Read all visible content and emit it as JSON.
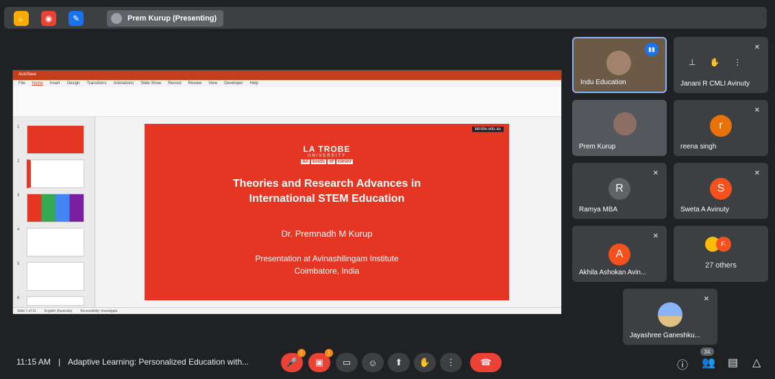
{
  "topbar": {
    "presenter_label": "Prem Kurup (Presenting)",
    "icons": [
      "hand-wave-icon",
      "record-icon",
      "edit-icon"
    ]
  },
  "presentation": {
    "title_bar_text": "AutoSave",
    "ribbon_tabs": [
      "File",
      "Home",
      "Insert",
      "Design",
      "Transitions",
      "Animations",
      "Slide Show",
      "Record",
      "Review",
      "View",
      "Developer",
      "Help"
    ],
    "slide": {
      "badge": "latrobe.edu.au",
      "logo_line1": "LA TROBE",
      "logo_line2": "UNIVERSITY",
      "tagline_all": "All",
      "tagline_kinds": "kinds",
      "tagline_of": "of",
      "tagline_clever": "clever",
      "title_line1": "Theories and Research Advances in",
      "title_line2": "International STEM Education",
      "author": "Dr. Premnadh M Kurup",
      "presentation_line1": "Presentation at Avinashilingam Institute",
      "presentation_line2": "Coimbatore, India"
    },
    "status_left": "Slide 1 of 31",
    "status_lang": "English (Australia)",
    "status_access": "Accessibility: Investigate",
    "thumb_numbers": [
      "1",
      "2",
      "3",
      "4",
      "5",
      "6"
    ]
  },
  "participants": [
    {
      "name": "Indu Education",
      "type": "video"
    },
    {
      "name": "Janani R CMLI Avinuty",
      "type": "icons"
    },
    {
      "name": "Prem Kurup",
      "type": "video"
    },
    {
      "name": "reena singh",
      "initial": "r",
      "color": "#e8710a"
    },
    {
      "name": "Ramya MBA",
      "initial": "R",
      "color": "#5f6368"
    },
    {
      "name": "Sweta A Avinuty",
      "initial": "S",
      "color": "#f4511e"
    },
    {
      "name": "Akhila Ashokan Avin...",
      "initial": "A",
      "color": "#f4511e"
    },
    {
      "name": "27 others",
      "initial": "F.",
      "color": "#f4511e"
    },
    {
      "name": "Jayashree Ganeshku..."
    }
  ],
  "bottom": {
    "time": "11:15 AM",
    "separator": "|",
    "meeting_title": "Adaptive Learning: Personalized Education with...",
    "participant_count": "34",
    "mic_badge": "!",
    "cam_badge": "!"
  }
}
